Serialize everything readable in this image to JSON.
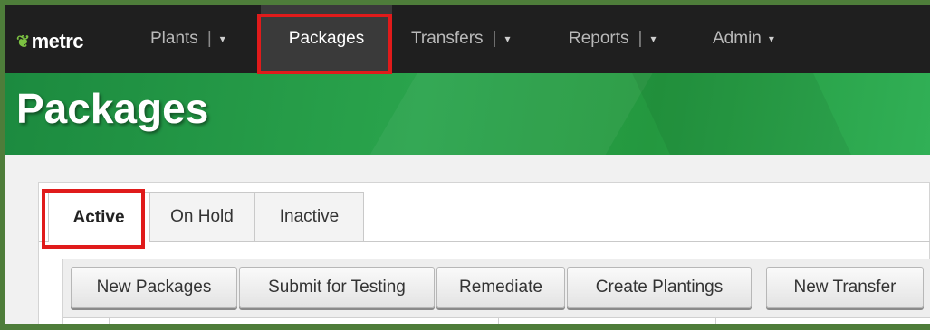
{
  "brand": {
    "logo_text": "metrc"
  },
  "nav": {
    "items": [
      {
        "label": "Plants"
      },
      {
        "label": "Packages"
      },
      {
        "label": "Transfers"
      },
      {
        "label": "Reports"
      },
      {
        "label": "Admin"
      }
    ],
    "separator": "|",
    "caret": "▾"
  },
  "page": {
    "title": "Packages"
  },
  "tabs": [
    {
      "label": "Active"
    },
    {
      "label": "On Hold"
    },
    {
      "label": "Inactive"
    }
  ],
  "toolbar": {
    "buttons": [
      {
        "label": "New Packages"
      },
      {
        "label": "Submit for Testing"
      },
      {
        "label": "Remediate"
      },
      {
        "label": "Create Plantings"
      },
      {
        "label": "New Transfer"
      }
    ]
  },
  "colors": {
    "highlight": "#e01b1b",
    "brand_green": "#2aa44c",
    "frame_green": "#4e7d3a",
    "navbar": "#1f1f1f"
  }
}
